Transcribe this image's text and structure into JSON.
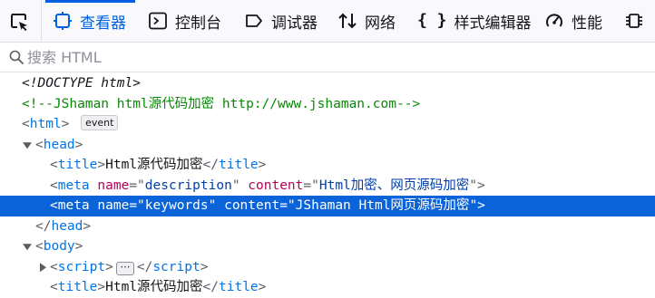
{
  "toolbar": {
    "tabs": [
      {
        "label": "查看器",
        "icon": "inspector-icon",
        "active": true
      },
      {
        "label": "控制台",
        "icon": "console-icon"
      },
      {
        "label": "调试器",
        "icon": "debugger-icon"
      },
      {
        "label": "网络",
        "icon": "network-icon"
      },
      {
        "label": "样式编辑器",
        "icon": "style-editor-icon"
      },
      {
        "label": "性能",
        "icon": "performance-icon"
      }
    ]
  },
  "search": {
    "placeholder": "搜索 HTML"
  },
  "tree": {
    "doctype": "<!DOCTYPE html>",
    "comment": "<!--JShaman html源代码加密 http://www.jshaman.com-->",
    "html_tag": "html",
    "event_badge": "event",
    "head_tag": "head",
    "title_tag": "title",
    "title_text": "Html源代码加密",
    "meta_tag": "meta",
    "attr_name": "name",
    "attr_content": "content",
    "meta1_name": "description",
    "meta1_content": "Html加密、网页源码加密",
    "meta2_name": "keywords",
    "meta2_content": "JShaman Html网页源码加密",
    "body_tag": "body",
    "script_tag": "script",
    "ellipsis": "⋯",
    "title2_text": "Html源代码加密"
  },
  "colors": {
    "accent": "#0060df",
    "selection": "#0a63d8",
    "tag": "#0074e8",
    "attr_name": "#b4005a",
    "attr_value": "#003eaa",
    "comment": "#058b00"
  }
}
